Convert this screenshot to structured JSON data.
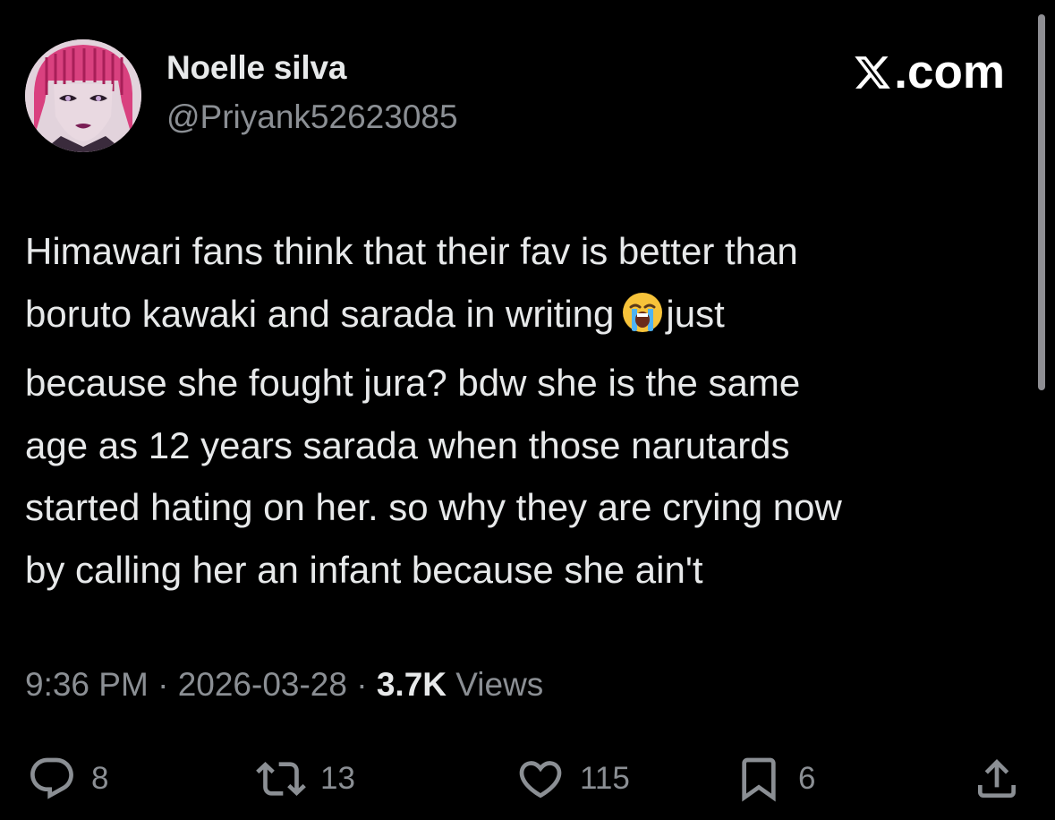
{
  "author": {
    "display_name": "Noelle silva",
    "handle": "@Priyank52623085"
  },
  "brand": {
    "logo_text": ".com",
    "logo_icon": "x-logo-icon"
  },
  "tweet": {
    "lines": [
      "Himawari fans think that their fav is better than",
      "boruto kawaki and sarada in writing",
      "just",
      "because she fought jura? bdw she is the same",
      "age as 12 years sarada when those narutards",
      "started hating on her. so why they are crying now",
      "by calling her an infant because she ain't"
    ],
    "emoji": "loudly-crying-face-emoji"
  },
  "meta": {
    "time": "9:36 PM",
    "separator": " · ",
    "date": "2026-03-28",
    "views_count": "3.7K",
    "views_label": " Views"
  },
  "actions": {
    "replies": "8",
    "retweets": "13",
    "likes": "115",
    "bookmarks": "6"
  },
  "colors": {
    "background": "#000000",
    "primary_text": "#e7e9ea",
    "secondary_text": "#8b8f94",
    "accent": "#1d9bf0"
  }
}
